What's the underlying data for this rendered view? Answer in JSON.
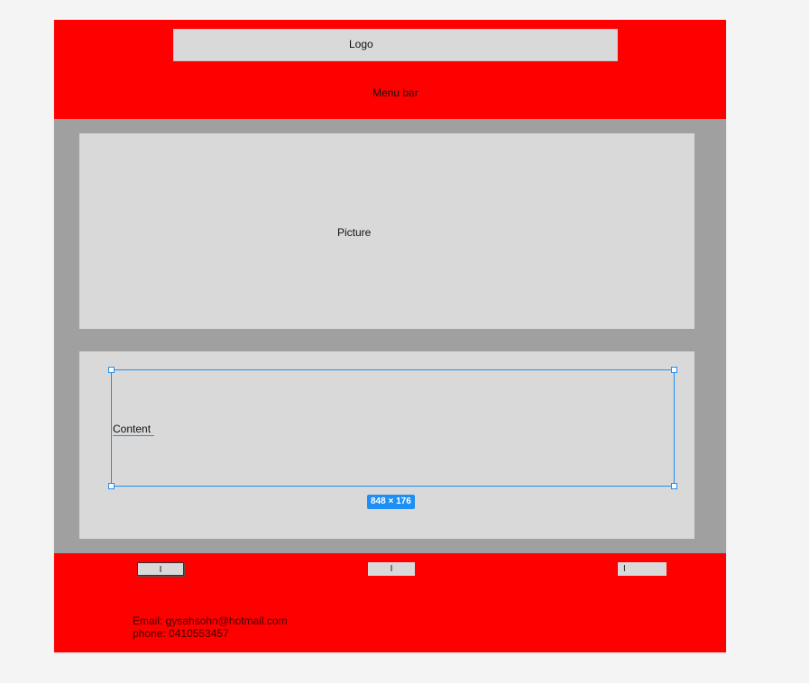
{
  "header": {
    "logo_label": "Logo",
    "menu_label": "Menu bar"
  },
  "main": {
    "picture_label": "Picture",
    "content_label": "Content",
    "selection_size": "848 × 176"
  },
  "footer": {
    "buttons": [
      "I",
      "I",
      "I"
    ],
    "email": "Email: gysahsohn@hotmail.com",
    "phone": "phone: 0410553457"
  },
  "colors": {
    "header_bg": "#ff0000",
    "panel_bg": "#a0a0a0",
    "box_bg": "#d9d9d9",
    "selection_accent": "#1e8ff5"
  }
}
